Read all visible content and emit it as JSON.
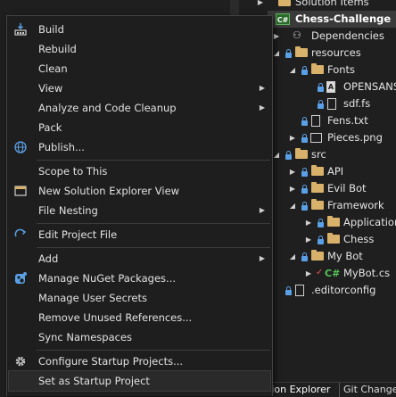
{
  "explorer": {
    "rows": [
      {
        "label": "Solution Items"
      },
      {
        "label": "Chess-Challenge",
        "badge": "C#"
      },
      {
        "label": "Dependencies"
      },
      {
        "label": "resources"
      },
      {
        "label": "Fonts"
      },
      {
        "label": "OPENSANS"
      },
      {
        "label": "sdf.fs"
      },
      {
        "label": "Fens.txt"
      },
      {
        "label": "Pieces.png"
      },
      {
        "label": "src"
      },
      {
        "label": "API"
      },
      {
        "label": "Evil Bot"
      },
      {
        "label": "Framework"
      },
      {
        "label": "Application"
      },
      {
        "label": "Chess"
      },
      {
        "label": "My Bot"
      },
      {
        "label": "MyBot.cs",
        "badge": "C#"
      },
      {
        "label": ".editorconfig"
      }
    ],
    "tabs": [
      "Solution Explorer",
      "Git Changes"
    ],
    "tabs_visible": [
      "tion Explorer",
      "Git Change"
    ]
  },
  "menu": {
    "items": [
      {
        "label": "Build",
        "icon": "build-icon"
      },
      {
        "label": "Rebuild"
      },
      {
        "label": "Clean"
      },
      {
        "label": "View",
        "submenu": true
      },
      {
        "label": "Analyze and Code Cleanup",
        "submenu": true
      },
      {
        "label": "Pack"
      },
      {
        "label": "Publish...",
        "icon": "globe-icon"
      },
      {
        "label": "Scope to This"
      },
      {
        "label": "New Solution Explorer View",
        "icon": "new-view-icon"
      },
      {
        "label": "File Nesting",
        "submenu": true
      },
      {
        "label": "Edit Project File",
        "icon": "edit-project-icon"
      },
      {
        "label": "Add",
        "submenu": true
      },
      {
        "label": "Manage NuGet Packages...",
        "icon": "nuget-icon"
      },
      {
        "label": "Manage User Secrets"
      },
      {
        "label": "Remove Unused References..."
      },
      {
        "label": "Sync Namespaces"
      },
      {
        "label": "Configure Startup Projects...",
        "icon": "gear-icon"
      },
      {
        "label": "Set as Startup Project"
      }
    ],
    "submenu_arrow": "▶"
  },
  "colors": {
    "background": "#1f1f1f",
    "menu_bg": "#1e1e1e",
    "folder": "#d8b26a",
    "accent_blue": "#5aa0e6",
    "csharp_green": "#58c458"
  }
}
